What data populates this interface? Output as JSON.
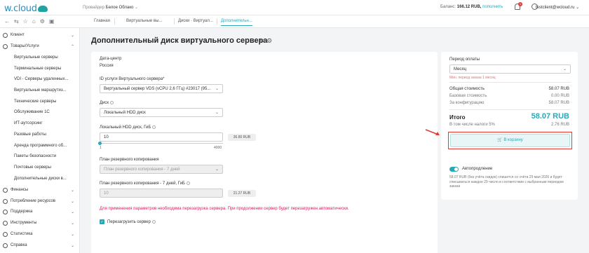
{
  "header": {
    "logo": "w.cloud",
    "provider_label": "Провайдер",
    "provider_name": "Белое Облако",
    "balance_label": "Баланс:",
    "balance_value": "166.12 RUB,",
    "topup": "пополнить",
    "notifications_count": "1",
    "username": "testclient@wcloud.ru"
  },
  "tabs": [
    {
      "label": "Главная"
    },
    {
      "label": "Виртуальные вы..."
    },
    {
      "label": "Диски · Виртуал..."
    },
    {
      "label": "Дополнительн..."
    }
  ],
  "sidebar": {
    "items": [
      {
        "label": "Клиент"
      },
      {
        "label": "Товары/Услуги"
      },
      {
        "label": "Финансы"
      },
      {
        "label": "Потребление ресурсов"
      },
      {
        "label": "Поддержка"
      },
      {
        "label": "Инструменты"
      },
      {
        "label": "Статистика"
      },
      {
        "label": "Справка"
      }
    ],
    "subitems": [
      {
        "label": "Виртуальные серверы"
      },
      {
        "label": "Терминальные серверы"
      },
      {
        "label": "VDI - Серверы удаленных..."
      },
      {
        "label": "Виртуальные маршрутиз..."
      },
      {
        "label": "Технические серверы"
      },
      {
        "label": "Обслуживание 1С"
      },
      {
        "label": "ИТ-аутсорсинг"
      },
      {
        "label": "Разовые работы"
      },
      {
        "label": "Аренда программного об..."
      },
      {
        "label": "Пакеты безопасности"
      },
      {
        "label": "Почтовые серверы"
      },
      {
        "label": "Дополнительные диски в..."
      }
    ]
  },
  "page": {
    "title": "Дополнительный диск виртуального сервера"
  },
  "form": {
    "datacenter_label": "Дата-центр",
    "datacenter_value": "Россия",
    "service_id_label": "ID услуги Виртуального сервера*",
    "service_id_value": "Виртуальный сервер VDS (vCPU 2,6 ГГц) #23017 (95...",
    "disk_label": "Диск",
    "disk_value": "Локальный HDD диск",
    "hdd_label": "Локальный HDD диск, ГиБ",
    "hdd_value": "10",
    "hdd_price": "36.80 RUB",
    "hdd_slider_fraction": 0.0,
    "slider_min": "1",
    "slider_max": "4000",
    "backup_plan_label": "План резервного копирования",
    "backup_plan_value": "План резервного копирования - 7 дней",
    "backup_size_label": "План резервного копирования - 7 дней, ГиБ",
    "backup_size_value": "10",
    "backup_price": "21.27 RUB",
    "warning": "Для применения параметров необходима перезагрузка сервера. При продолжении сервер будет перезагружен автоматически.",
    "reboot_label": "Перезагрузить сервер"
  },
  "summary": {
    "period_label": "Период оплаты",
    "period_value": "Месяц",
    "min_period": "Мин. период заказа 1 месяц",
    "total_cost_label": "Общая стоимость",
    "total_cost_value": "58.07 RUB",
    "base_cost_label": "Базовая стоимость",
    "base_cost_value": "0.00 RUB",
    "config_label": "За конфигурацию",
    "config_value": "58.07 RUB",
    "total_label": "Итого",
    "total_value": "58.07 RUB",
    "tax_label": "В том числе налоги 5%",
    "tax_value": "2.76 RUB",
    "cart_button": "В корзину"
  },
  "autorenew": {
    "title": "Автопродление",
    "description": "58.07 RUB (без учёта скидок) спишется со счёта 29 мая 2026 и будет списываться каждое 29 число в соответствии с выбранным периодом заказа"
  },
  "colors": {
    "accent": "#27a9b8",
    "warning": "#d81b60",
    "highlight": "#e53935"
  }
}
